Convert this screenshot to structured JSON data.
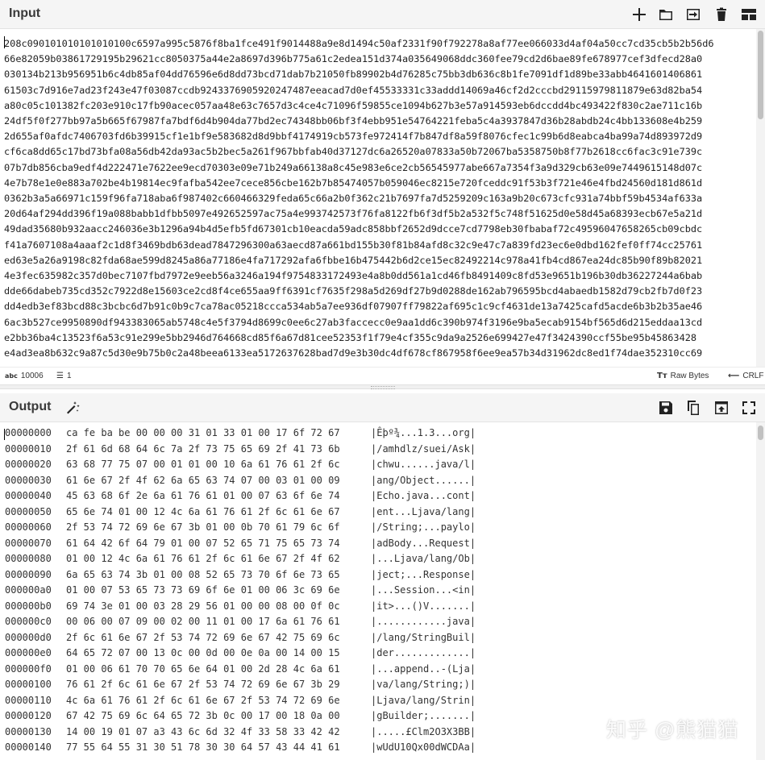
{
  "input": {
    "title": "Input",
    "icons": [
      "plus-icon",
      "folder-icon",
      "import-icon",
      "trash-icon",
      "layout-icon"
    ],
    "lines": [
      "208c090101010101010100c6597a995c5876f8ba1fce491f9014488a9e8d1494c50af2331f90f792278a8af77ee066033d4af04a50cc7cd35cb5b2b56d6",
      "66e82059b03861729195b29621cc8050375a44e2a8697d396b775a61c2edea151d374a035649068ddc360fee79cd2d6bae89fe678977cef3dfecd28a0",
      "030134b213b956951b6c4db85af04dd76596e6d8dd73bcd71dab7b21050fb89902b4d76285c75bb3db636c8b1fe7091df1d89be33abb4641601406861",
      "61503c7d916e7ad23f243e47f03087ccdb9243376905920247487eeacad7d0ef45533331c33addd14069a46cf2d2cccbd29115979811879e63d82ba54",
      "a80c05c101382fc203e910c17fb90acec057aa48e63c7657d3c4ce4c71096f59855ce1094b627b3e57a914593eb6dccdd4bc493422f830c2ae711c16b",
      "24df5f0f277bb97a5b665f67987fa7bdf6d4b904da77bd2ec74348bb06bf3f4ebb951e54764221feba5c4a3937847d36b28abdb24c4bb133608e4b259",
      "2d655af0afdc7406703fd6b39915cf1e1bf9e583682d8d9bbf4174919cb573fe972414f7b847df8a59f8076cfec1c99b6d8eabca4ba99a74d893972d9",
      "cf6ca8dd65c17bd73bfa08a56db42da93ac5b2bec5a261f967bbfab40d37127dc6a26520a07833a50b72067ba5358750b8f77b2618cc6fac3c91e739c",
      "07b7db856cba9edf4d222471e7622ee9ecd70303e09e71b249a66138a8c45e983e6ce2cb56545977abe667a7354f3a9d329cb63e09e7449615148d07c",
      "4e7b78e1e0e883a702be4b19814ec9fafba542ee7cece856cbe162b7b85474057b059046ec8215e720fceddc91f53b3f721e46e4fbd24560d181d861d",
      "0362b3a5a66971c159f96fa718aba6f987402c660466329feda65c66a2b0f362c21b7697fa7d5259209c163a9b20c673cfc931a74bbf59b4534af633a",
      "20d64af294dd396f19a088babb1dfbb5097e492652597ac75a4e993742573f76fa8122fb6f3df5b2a532f5c748f51625d0e58d45a68393ecb67e5a21d",
      "49dad35680b932aacc246036e3b1296a94b4d5efb5fd67301cb10eacda59adc858bbf2652d9dcce7cd7798eb30fbabaf72c49596047658265cb09cbdc",
      "f41a7607108a4aaaf2c1d8f3469bdb63dead7847296300a63aecd87a661bd155b30f81b84afd8c32c9e47c7a839fd23ec6e0dbd162fef0ff74cc25761",
      "ed63e5a26a9198c82fda68ae599d8245a86a77186e4fa717292afa6fbbe16b475442b6d2ce15ec82492214c978a41fb4cd867ea24dc85b90f89b82021",
      "4e3fec635982c357d0bec7107fbd7972e9eeb56a3246a194f9754833172493e4a8b0dd561a1cd46fb8491409c8fd53e9651b196b30db36227244a6bab",
      "dde66dabeb735cd352c7922d8e15603ce2cd8f4ce655aa9ff6391cf7635f298a5d269df27b9d0288de162ab796595bcd4abaedb1582d79cb2fb7d0f23",
      "dd4edb3ef83bcd88c3bcbc6d7b91c0b9c7ca78ac05218ccca534ab5a7ee936df07907ff79822af695c1c9cf4631de13a7425cafd5acde6b3b2b35ae46",
      "6ac3b527ce9950890df943383065ab5748c4e5f3794d8699c0ee6c27ab3faccecc0e9aa1dd6c390b974f3196e9ba5ecab9154bf565d6d215eddaa13cd",
      "e2bb36ba4c13523f6a53c91e299e5bb2946d764668cd85f6a67d81cee52353f1f79e4cf355c9da9a2526e699427e47f3424390ccf55be95b45863428",
      "e4ad3ea8b632c9a87c5d30e9b75b0c2a48beea6133ea5172637628bad7d9e3b30dc4df678cf867958f6ee9ea57b34d31962dc8ed1f74dae352310cc69"
    ],
    "status": {
      "char_count_icon": "abc",
      "char_count": "10006",
      "line_count": "1",
      "encoding_label": "Raw Bytes",
      "eol_label": "CRLF"
    }
  },
  "output": {
    "title": "Output",
    "icons": [
      "magic-wand-icon",
      "save-icon",
      "copy-icon",
      "open-in-input-icon",
      "maximize-icon"
    ],
    "rows": [
      {
        "offset": "00000000",
        "hex": "ca fe ba be 00 00 00 31 01 33 01 00 17 6f 72 67",
        "ascii": "|Êþº¾...1.3...org|"
      },
      {
        "offset": "00000010",
        "hex": "2f 61 6d 68 64 6c 7a 2f 73 75 65 69 2f 41 73 6b",
        "ascii": "|/amhdlz/suei/Ask|"
      },
      {
        "offset": "00000020",
        "hex": "63 68 77 75 07 00 01 01 00 10 6a 61 76 61 2f 6c",
        "ascii": "|chwu......java/l|"
      },
      {
        "offset": "00000030",
        "hex": "61 6e 67 2f 4f 62 6a 65 63 74 07 00 03 01 00 09",
        "ascii": "|ang/Object......|"
      },
      {
        "offset": "00000040",
        "hex": "45 63 68 6f 2e 6a 61 76 61 01 00 07 63 6f 6e 74",
        "ascii": "|Echo.java...cont|"
      },
      {
        "offset": "00000050",
        "hex": "65 6e 74 01 00 12 4c 6a 61 76 61 2f 6c 61 6e 67",
        "ascii": "|ent...Ljava/lang|"
      },
      {
        "offset": "00000060",
        "hex": "2f 53 74 72 69 6e 67 3b 01 00 0b 70 61 79 6c 6f",
        "ascii": "|/String;...paylo|"
      },
      {
        "offset": "00000070",
        "hex": "61 64 42 6f 64 79 01 00 07 52 65 71 75 65 73 74",
        "ascii": "|adBody...Request|"
      },
      {
        "offset": "00000080",
        "hex": "01 00 12 4c 6a 61 76 61 2f 6c 61 6e 67 2f 4f 62",
        "ascii": "|...Ljava/lang/Ob|"
      },
      {
        "offset": "00000090",
        "hex": "6a 65 63 74 3b 01 00 08 52 65 73 70 6f 6e 73 65",
        "ascii": "|ject;...Response|"
      },
      {
        "offset": "000000a0",
        "hex": "01 00 07 53 65 73 73 69 6f 6e 01 00 06 3c 69 6e",
        "ascii": "|...Session...<in|"
      },
      {
        "offset": "000000b0",
        "hex": "69 74 3e 01 00 03 28 29 56 01 00 00 08 00 0f 0c",
        "ascii": "|it>...()V.......|"
      },
      {
        "offset": "000000c0",
        "hex": "00 06 00 07 09 00 02 00 11 01 00 17 6a 61 76 61",
        "ascii": "|............java|"
      },
      {
        "offset": "000000d0",
        "hex": "2f 6c 61 6e 67 2f 53 74 72 69 6e 67 42 75 69 6c",
        "ascii": "|/lang/StringBuil|"
      },
      {
        "offset": "000000e0",
        "hex": "64 65 72 07 00 13 0c 00 0d 00 0e 0a 00 14 00 15",
        "ascii": "|der.............|"
      },
      {
        "offset": "000000f0",
        "hex": "01 00 06 61 70 70 65 6e 64 01 00 2d 28 4c 6a 61",
        "ascii": "|...append..-(Lja|"
      },
      {
        "offset": "00000100",
        "hex": "76 61 2f 6c 61 6e 67 2f 53 74 72 69 6e 67 3b 29",
        "ascii": "|va/lang/String;)|"
      },
      {
        "offset": "00000110",
        "hex": "4c 6a 61 76 61 2f 6c 61 6e 67 2f 53 74 72 69 6e",
        "ascii": "|Ljava/lang/Strin|"
      },
      {
        "offset": "00000120",
        "hex": "67 42 75 69 6c 64 65 72 3b 0c 00 17 00 18 0a 00",
        "ascii": "|gBuilder;.......|"
      },
      {
        "offset": "00000130",
        "hex": "14 00 19 01 07 a3 43 6c 6d 32 4f 33 58 33 42 42",
        "ascii": "|.....£Clm2O3X3BB|"
      },
      {
        "offset": "00000140",
        "hex": "77 55 64 55 31 30 51 78 30 30 64 57 43 44 41 61",
        "ascii": "|wUdU10Qx00dWCDAa|"
      }
    ]
  },
  "watermark": "知乎 @熊猫猫"
}
